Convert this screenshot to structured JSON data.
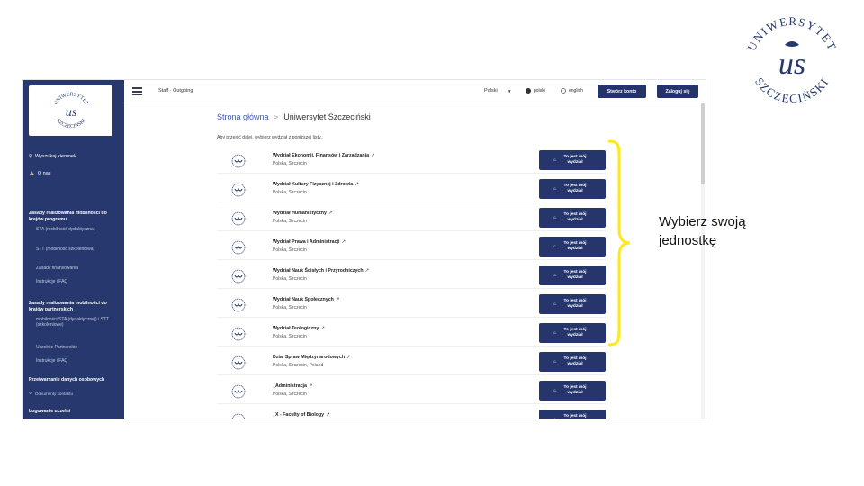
{
  "logo": {
    "arc_top": "UNIWERSYTET",
    "arc_bottom": "SZCZECIŃSKI",
    "monogram": "us"
  },
  "sidebar": {
    "search_label": "Wyszukaj kierunek",
    "about_label": "O nas",
    "sections": [
      {
        "title": "Zasady realizowania mobilności do krajów programu",
        "items": [
          "STA (mobilność dydaktyczna)",
          "STT (mobilność szkoleniowa)",
          "Zasady finansowania",
          "Instrukcje i FAQ"
        ]
      },
      {
        "title": "Zasady realizowania mobilności do krajów partnerskich",
        "items": [
          "mobilności STA (dydaktycznej) i STT (szkoleniowe)",
          "Uczelnie Partnerskie",
          "Instrukcje i FAQ"
        ]
      },
      {
        "title": "Przetwarzanie danych osobowych",
        "items": [
          "Dokumenty kontaktu"
        ]
      }
    ],
    "last_section": "Logowanie uczelni"
  },
  "topbar": {
    "nav": "Staff · Outgoing",
    "language": "Polski",
    "radio_polish": "polski",
    "radio_english": "english",
    "create_account": "Stwórz konto",
    "login": "Zaloguj się"
  },
  "breadcrumb": {
    "home": "Strona główna",
    "separator": ">",
    "current": "Uniwersytet Szczeciński"
  },
  "instructions": "Aby przejść dalej, wybierz wydział z poniższej listy.",
  "button_label": "To jest mój wydział",
  "units": [
    {
      "name": "Wydział Ekonomii, Finansów i Zarządzania",
      "location": "Polska, Szczecin"
    },
    {
      "name": "Wydział Kultury Fizycznej i Zdrowia",
      "location": "Polska, Szczecin"
    },
    {
      "name": "Wydział Humanistyczny",
      "location": "Polska, Szczecin"
    },
    {
      "name": "Wydział Prawa i Administracji",
      "location": "Polska, Szczecin"
    },
    {
      "name": "Wydział Nauk Ścisłych i Przyrodniczych",
      "location": "Polska, Szczecin"
    },
    {
      "name": "Wydział Nauk Społecznych",
      "location": "Polska, Szczecin"
    },
    {
      "name": "Wydział Teologiczny",
      "location": "Polska, Szczecin"
    },
    {
      "name": "Dział Spraw Międzynarodowych",
      "location": "Polska, Szczecin, Poland"
    },
    {
      "name": "_Administracja",
      "location": "Polska, Szczecin"
    },
    {
      "name": "_X - Faculty of Biology",
      "location": "Polska, Szczecin"
    }
  ],
  "annotation": "Wybierz swoją jednostkę",
  "colors": {
    "sidebar": "#26386d",
    "button": "#26356b",
    "brace": "#ffe81a",
    "link": "#3e5ba8"
  }
}
